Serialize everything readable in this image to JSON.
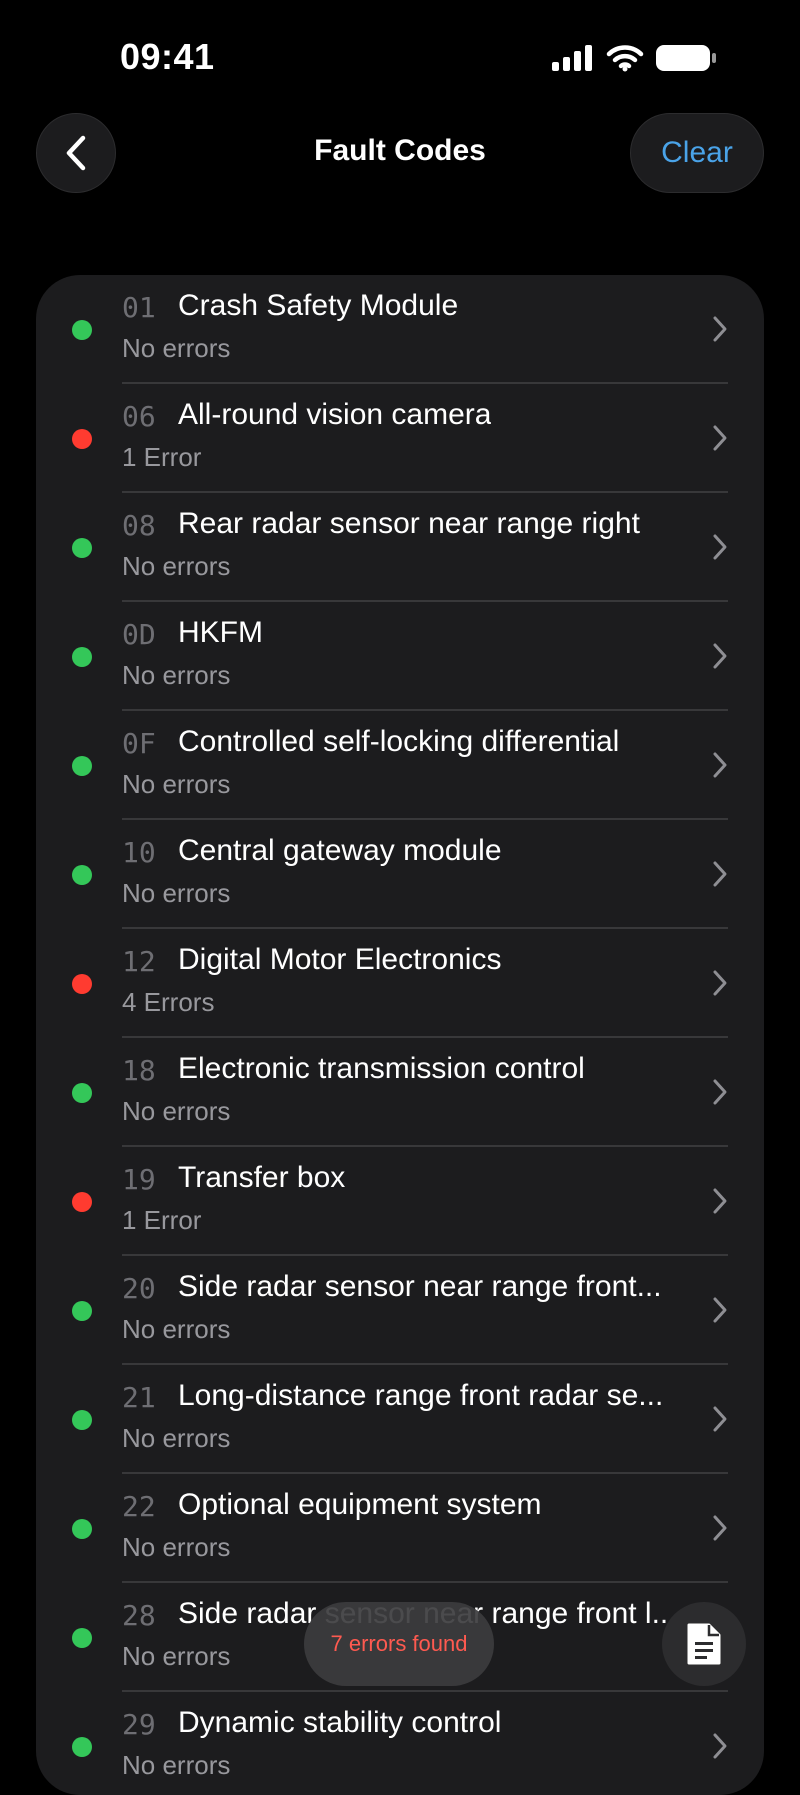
{
  "status_bar": {
    "time": "09:41",
    "icons": [
      "signal-icon",
      "wifi-icon",
      "battery-icon"
    ]
  },
  "nav": {
    "title": "Fault Codes",
    "clear_label": "Clear",
    "back_icon": "chevron-left-icon"
  },
  "colors": {
    "accent": "#4aa3e8",
    "ok": "#34c759",
    "error": "#ff3b30"
  },
  "modules": [
    {
      "code": "01",
      "name": "Crash Safety Module",
      "status": "No errors",
      "state": "ok"
    },
    {
      "code": "06",
      "name": "All-round vision camera",
      "status": "1 Error",
      "state": "err"
    },
    {
      "code": "08",
      "name": "Rear radar sensor near range right",
      "status": "No errors",
      "state": "ok"
    },
    {
      "code": "0D",
      "name": "HKFM",
      "status": "No errors",
      "state": "ok"
    },
    {
      "code": "0F",
      "name": "Controlled self-locking differential",
      "status": "No errors",
      "state": "ok"
    },
    {
      "code": "10",
      "name": "Central gateway module",
      "status": "No errors",
      "state": "ok"
    },
    {
      "code": "12",
      "name": "Digital Motor Electronics",
      "status": "4 Errors",
      "state": "err"
    },
    {
      "code": "18",
      "name": "Electronic transmission control",
      "status": "No errors",
      "state": "ok"
    },
    {
      "code": "19",
      "name": "Transfer box",
      "status": "1 Error",
      "state": "err"
    },
    {
      "code": "20",
      "name": "Side radar sensor near range front...",
      "status": "No errors",
      "state": "ok"
    },
    {
      "code": "21",
      "name": "Long-distance range front radar se...",
      "status": "No errors",
      "state": "ok"
    },
    {
      "code": "22",
      "name": "Optional equipment system",
      "status": "No errors",
      "state": "ok"
    },
    {
      "code": "28",
      "name": "Side radar sensor near range front l...",
      "status": "No errors",
      "state": "ok"
    },
    {
      "code": "29",
      "name": "Dynamic stability control",
      "status": "No errors",
      "state": "ok"
    }
  ],
  "toast": {
    "text": "7 errors found"
  },
  "fab": {
    "icon": "document-icon"
  }
}
